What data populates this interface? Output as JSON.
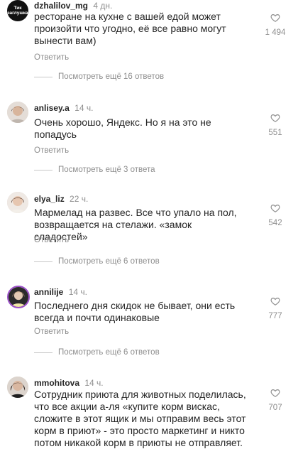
{
  "comments": [
    {
      "username": "dzhalilov_mg",
      "time": "4 дн.",
      "avatar_text": [
        "Тик",
        "заглушка"
      ],
      "lines": [
        "ресторане на кухне с вашей едой может",
        "произойти что угодно, её все равно могут",
        "вынести вам)"
      ],
      "reply_label": "Ответить",
      "view_replies": "Посмотреть ещё 16 ответов",
      "likes": "1 494"
    },
    {
      "username": "anlisey.a",
      "time": "14 ч.",
      "lines": [
        "Очень хорошо, Яндекс. Но я на это не",
        "попадусь"
      ],
      "reply_label": "Ответить",
      "view_replies": "Посмотреть ещё 3 ответа",
      "likes": "551"
    },
    {
      "username": "elya_liz",
      "time": "22 ч.",
      "lines": [
        "Мармелад на развес. Все что упало на пол,",
        "возвращается на стелажи. «замок сладостей»"
      ],
      "reply_label": "Ответить",
      "view_replies": "Посмотреть ещё 6 ответов",
      "likes": "542"
    },
    {
      "username": "annilije",
      "time": "14 ч.",
      "lines": [
        "Последнего дня скидок не бывает, они есть",
        "всегда и почти одинаковые"
      ],
      "reply_label": "Ответить",
      "view_replies": "Посмотреть ещё 6 ответов",
      "likes": "777"
    },
    {
      "username": "mmohitova",
      "time": "14 ч.",
      "lines": [
        "Сотрудник приюта для животных поделилась,",
        "что все акции а-ля «купите корм вискас,",
        "сложите в этот ящик и мы отправим весь этот",
        "корм в приют» - это просто маркетинг и никто",
        "потом никакой корм в приюты не отправляет."
      ],
      "likes": "707"
    }
  ],
  "icons": {
    "like": "heart-outline-icon"
  },
  "colors": {
    "text": "#262626",
    "secondary": "#8e8e8e",
    "divider": "#c7c7c7"
  }
}
